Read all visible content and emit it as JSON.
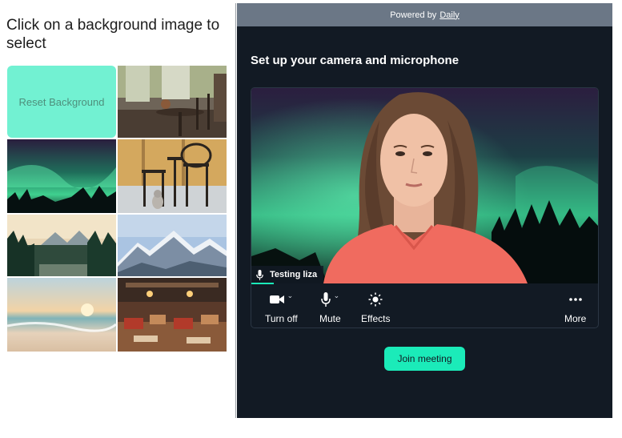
{
  "picker": {
    "title": "Click on a background image to select",
    "reset_label": "Reset Background",
    "tiles": [
      {
        "name": "cafe-interior"
      },
      {
        "name": "aurora-forest"
      },
      {
        "name": "cafe-chairs-cat"
      },
      {
        "name": "mountain-lake"
      },
      {
        "name": "snowy-mountains"
      },
      {
        "name": "beach-sunset"
      },
      {
        "name": "restaurant-interior"
      }
    ]
  },
  "daily": {
    "powered_prefix": "Powered by",
    "powered_link": "Daily",
    "setup_title": "Set up your camera and microphone",
    "participant_name": "Testing liza",
    "controls": {
      "camera_label": "Turn off",
      "mute_label": "Mute",
      "effects_label": "Effects",
      "more_label": "More"
    },
    "join_label": "Join meeting"
  },
  "colors": {
    "accent": "#1bebb9",
    "reset_tile": "#72f1d2",
    "panel_bg": "#121a24",
    "powered_bar": "#6b7786"
  }
}
